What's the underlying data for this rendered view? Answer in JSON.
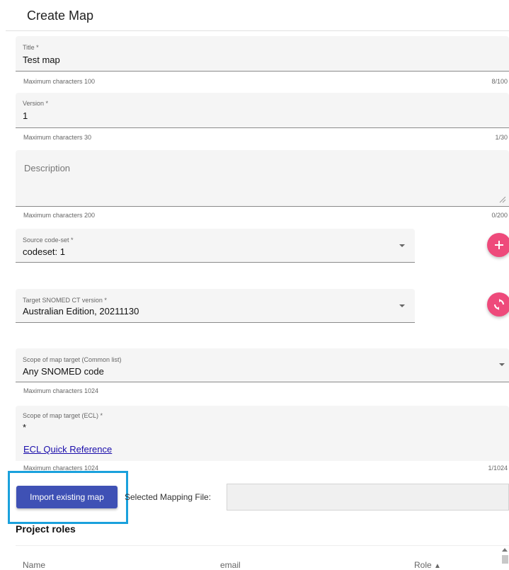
{
  "page": {
    "title": "Create Map"
  },
  "title_field": {
    "label": "Title *",
    "value": "Test map",
    "helper": "Maximum characters 100",
    "counter": "8/100"
  },
  "version_field": {
    "label": "Version *",
    "value": "1",
    "helper": "Maximum characters 30",
    "counter": "1/30"
  },
  "description_field": {
    "placeholder": "Description",
    "helper": "Maximum characters 200",
    "counter": "0/200"
  },
  "source_codeset": {
    "label": "Source code-set *",
    "value": "codeset: 1"
  },
  "target_snomed": {
    "label": "Target SNOMED CT version *",
    "value": "Australian Edition, 20211130"
  },
  "scope_common": {
    "label": "Scope of map target (Common list)",
    "value": "Any SNOMED code",
    "helper": "Maximum characters 1024"
  },
  "scope_ecl": {
    "label": "Scope of map target (ECL) *",
    "value": "*",
    "link": "ECL Quick Reference",
    "helper": "Maximum characters 1024",
    "counter": "1/1024"
  },
  "import": {
    "button_label": "Import existing map",
    "file_label": "Selected Mapping File:"
  },
  "project_roles": {
    "heading": "Project roles",
    "columns": [
      "Name",
      "email",
      "Role"
    ]
  },
  "colors": {
    "accent": "#3f51b5",
    "fab": "#ee4a7b",
    "highlight": "#1aa1dc"
  }
}
